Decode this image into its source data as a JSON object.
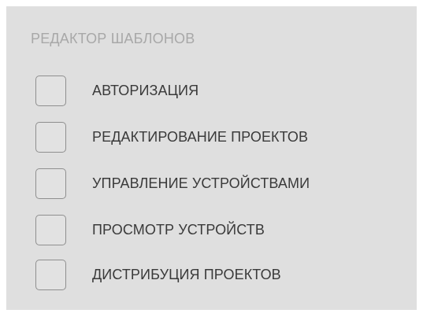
{
  "section": {
    "title": "РЕДАКТОР ШАБЛОНОВ",
    "options": [
      {
        "label": "АВТОРИЗАЦИЯ",
        "checked": false
      },
      {
        "label": "РЕДАКТИРОВАНИЕ ПРОЕКТОВ",
        "checked": false
      },
      {
        "label": "УПРАВЛЕНИЕ УСТРОЙСТВАМИ",
        "checked": false
      },
      {
        "label": "ПРОСМОТР УСТРОЙСТВ",
        "checked": false
      },
      {
        "label": "ДИСТРИБУЦИЯ ПРОЕКТОВ",
        "checked": false
      }
    ]
  },
  "colors": {
    "panel_background": "#dfdfdf",
    "title_text": "#a8a8a8",
    "label_text": "#3a3a3a",
    "checkbox_border": "#8f8f8f"
  }
}
